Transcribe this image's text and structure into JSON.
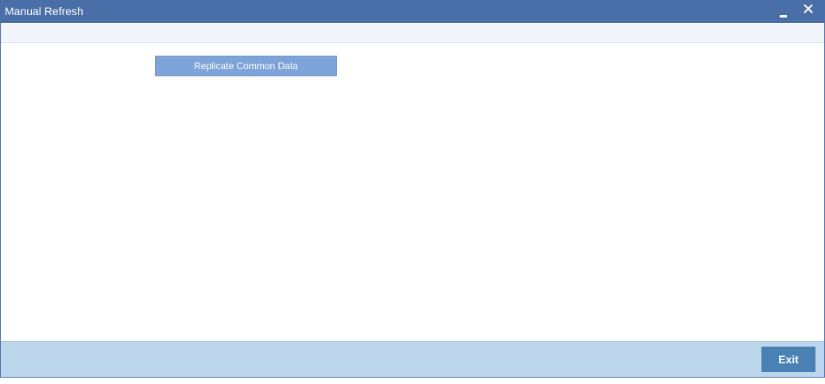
{
  "window": {
    "title": "Manual Refresh"
  },
  "main": {
    "replicate_label": "Replicate Common Data"
  },
  "footer": {
    "exit_label": "Exit"
  },
  "icons": {
    "minimize": "minimize-icon",
    "close": "close-icon"
  },
  "colors": {
    "titlebar": "#4a6fa8",
    "replicate_button": "#7ea3d8",
    "footer": "#bcd6ec",
    "exit_button": "#4a81b4"
  }
}
